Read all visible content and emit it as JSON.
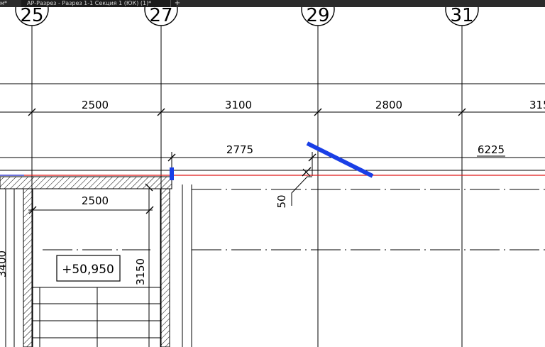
{
  "tabs": {
    "previous": "м*",
    "active": "АР-Разрез - Разрез 1-1 Секция 1 (ЮК) (1)*",
    "add": "+"
  },
  "grid": {
    "axis_1": "25",
    "axis_2": "27",
    "axis_3": "29",
    "axis_4": "31"
  },
  "dimensions": {
    "span_1": "2500",
    "span_2": "3100",
    "span_3": "2800",
    "span_4": "315",
    "chain_1": "2775",
    "chain_2": "6225",
    "room_width": "2500",
    "offset": "50",
    "height_room": "3150",
    "height_left": "3400"
  },
  "elevation": {
    "mark": "+50,950"
  },
  "colors": {
    "section_line": "#e01818",
    "highlight": "#1a3fe6",
    "tab_bar": "#2b2b2b"
  }
}
